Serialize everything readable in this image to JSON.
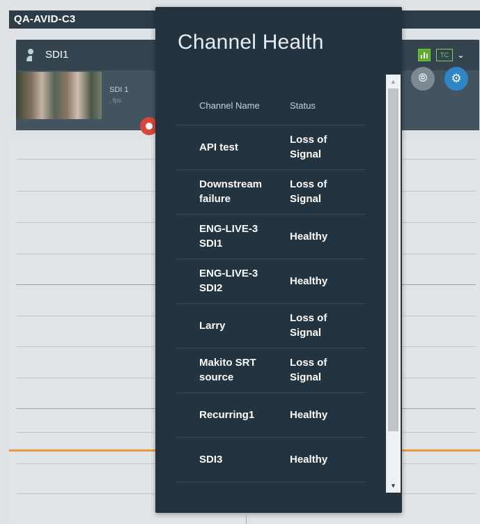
{
  "app": {
    "device_title": "QA-AVID-C3",
    "channel_name": "SDI1",
    "thumb_label": "SDI 1",
    "thumb_fps": ", fps",
    "tc_label": "TC"
  },
  "modal": {
    "title": "Channel Health",
    "columns": {
      "name": "Channel Name",
      "status": "Status"
    },
    "rows": [
      {
        "name": "API test",
        "status": "Loss of Signal"
      },
      {
        "name": "Downstream failure",
        "status": "Loss of Signal"
      },
      {
        "name": "ENG-LIVE-3 SDI1",
        "status": "Healthy"
      },
      {
        "name": "ENG-LIVE-3 SDI2",
        "status": "Healthy"
      },
      {
        "name": "Larry",
        "status": "Loss of Signal"
      },
      {
        "name": "Makito SRT source",
        "status": "Loss of Signal"
      },
      {
        "name": "Recurring1",
        "status": "Healthy"
      },
      {
        "name": "SDI3",
        "status": "Healthy"
      }
    ]
  },
  "icons": {
    "user": "user-icon",
    "meter": "meter-icon",
    "chevron": "chevron-down-icon",
    "link": "link-icon",
    "gear": "gear-icon",
    "record": "record-icon",
    "scroll_up": "scroll-up-icon",
    "scroll_down": "scroll-down-icon"
  },
  "colors": {
    "modal_bg": "#243340",
    "accent_blue": "#2f86c6",
    "record_red": "#d9473a",
    "meter_green": "#5cab2d",
    "timeline_orange": "#e99a3b"
  }
}
